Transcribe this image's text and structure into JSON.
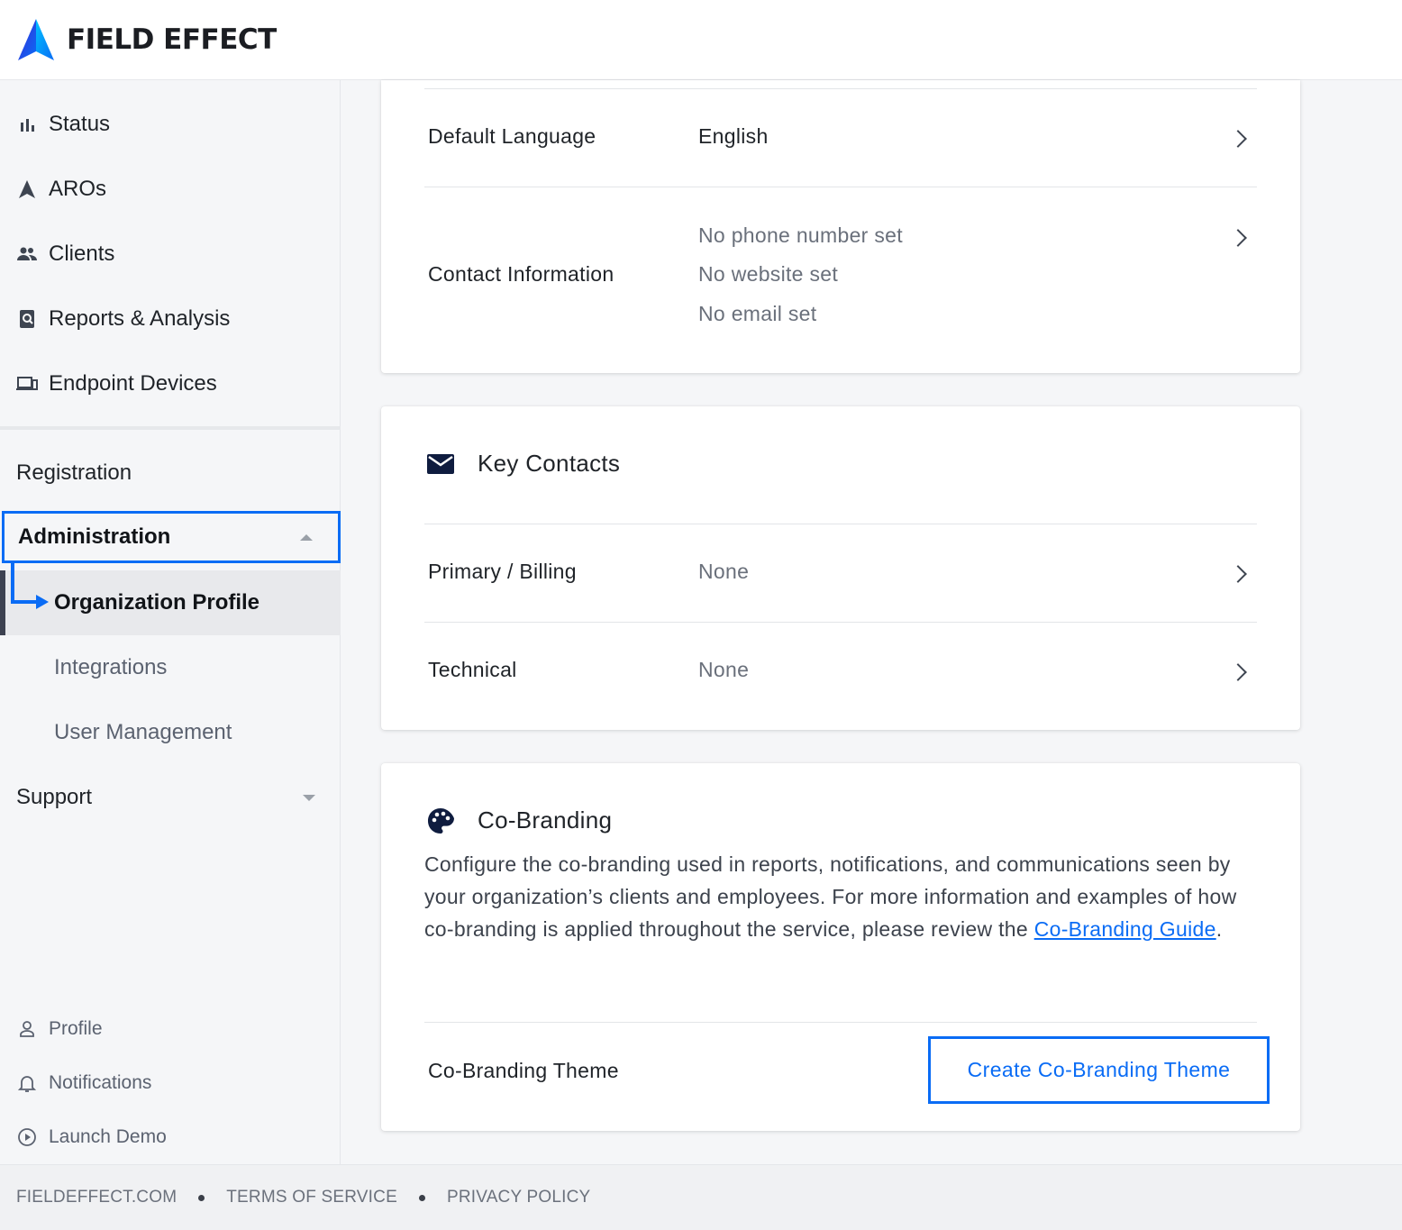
{
  "brand": {
    "name": "FIELD EFFECT",
    "logo_colors": [
      "#0a6cf5",
      "#5b2ee0",
      "#00b3ff"
    ]
  },
  "sidebar": {
    "main": [
      {
        "label": "Status",
        "icon": "bar-chart-icon"
      },
      {
        "label": "AROs",
        "icon": "aro-arrow-icon"
      },
      {
        "label": "Clients",
        "icon": "people-icon"
      },
      {
        "label": "Reports & Analysis",
        "icon": "report-search-icon"
      },
      {
        "label": "Endpoint Devices",
        "icon": "devices-icon"
      }
    ],
    "registration": "Registration",
    "administration": "Administration",
    "admin_items": [
      "Organization Profile",
      "Integrations",
      "User Management"
    ],
    "support": "Support",
    "bottom": [
      {
        "label": "Profile",
        "icon": "person-icon"
      },
      {
        "label": "Notifications",
        "icon": "bell-icon"
      },
      {
        "label": "Launch Demo",
        "icon": "play-circle-icon"
      }
    ]
  },
  "footer": {
    "links": [
      "FIELDEFFECT.COM",
      "TERMS OF SERVICE",
      "PRIVACY POLICY"
    ]
  },
  "general_card": {
    "default_language": {
      "label": "Default Language",
      "value": "English"
    },
    "contact_information": {
      "label": "Contact Information",
      "values": [
        "No phone number set",
        "No website set",
        "No email set"
      ]
    }
  },
  "key_contacts": {
    "title": "Key Contacts",
    "rows": [
      {
        "label": "Primary / Billing",
        "value": "None"
      },
      {
        "label": "Technical",
        "value": "None"
      }
    ]
  },
  "co_branding": {
    "title": "Co-Branding",
    "description": "Configure the co-branding used in reports, notifications, and communications seen by your organization’s clients and employees. For more information and examples of how co-branding is applied throughout the service, please review the ",
    "link_text": "Co-Branding Guide",
    "description_end": ".",
    "theme_label": "Co-Branding Theme",
    "cta_label": "Create Co-Branding Theme"
  },
  "colors": {
    "accent": "#0a6cf5",
    "active_bar": "#3c4150"
  }
}
